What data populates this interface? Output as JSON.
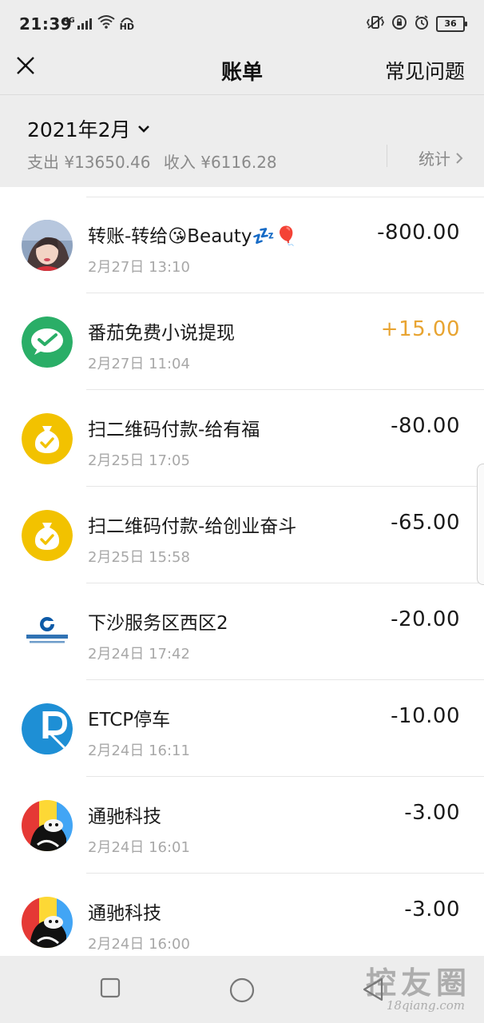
{
  "status_bar": {
    "time": "21:39",
    "network_label": "4G",
    "hd_label": "HD",
    "battery": "36"
  },
  "nav": {
    "title": "账单",
    "right_label": "常见问题"
  },
  "summary": {
    "month": "2021年2月",
    "expense": "支出 ¥13650.46",
    "income": "收入 ¥6116.28",
    "stats_label": "统计"
  },
  "colors": {
    "income_amount": "#e8a431",
    "wechat_green": "#2aae67",
    "wallet_yellow": "#f2c200",
    "etcp_blue": "#1e8fd5",
    "ccb_blue": "#0d5aa7"
  },
  "transactions": [
    {
      "title": "转账-转给😘Beauty💤🎈",
      "time": "2月27日 13:10",
      "amount": "-800.00",
      "avatar": "user-photo-avatar"
    },
    {
      "title": "番茄免费小说提现",
      "time": "2月27日 11:04",
      "amount": "+15.00",
      "avatar": "wechat-pay-icon"
    },
    {
      "title": "扫二维码付款-给有福",
      "time": "2月25日 17:05",
      "amount": "-80.00",
      "avatar": "money-bag-icon"
    },
    {
      "title": "扫二维码付款-给创业奋斗",
      "time": "2月25日 15:58",
      "amount": "-65.00",
      "avatar": "money-bag-icon"
    },
    {
      "title": "下沙服务区西区2",
      "time": "2月24日 17:42",
      "amount": "-20.00",
      "avatar": "ccb-bank-logo"
    },
    {
      "title": "ETCP停车",
      "time": "2月24日 16:11",
      "amount": "-10.00",
      "avatar": "etcp-logo"
    },
    {
      "title": "通驰科技",
      "time": "2月24日 16:01",
      "amount": "-3.00",
      "avatar": "cartoon-avatar"
    },
    {
      "title": "通驰科技",
      "time": "2月24日 16:00",
      "amount": "-3.00",
      "avatar": "cartoon-avatar"
    }
  ],
  "watermark": {
    "big": "控友圈",
    "small": "18qiang.com"
  }
}
